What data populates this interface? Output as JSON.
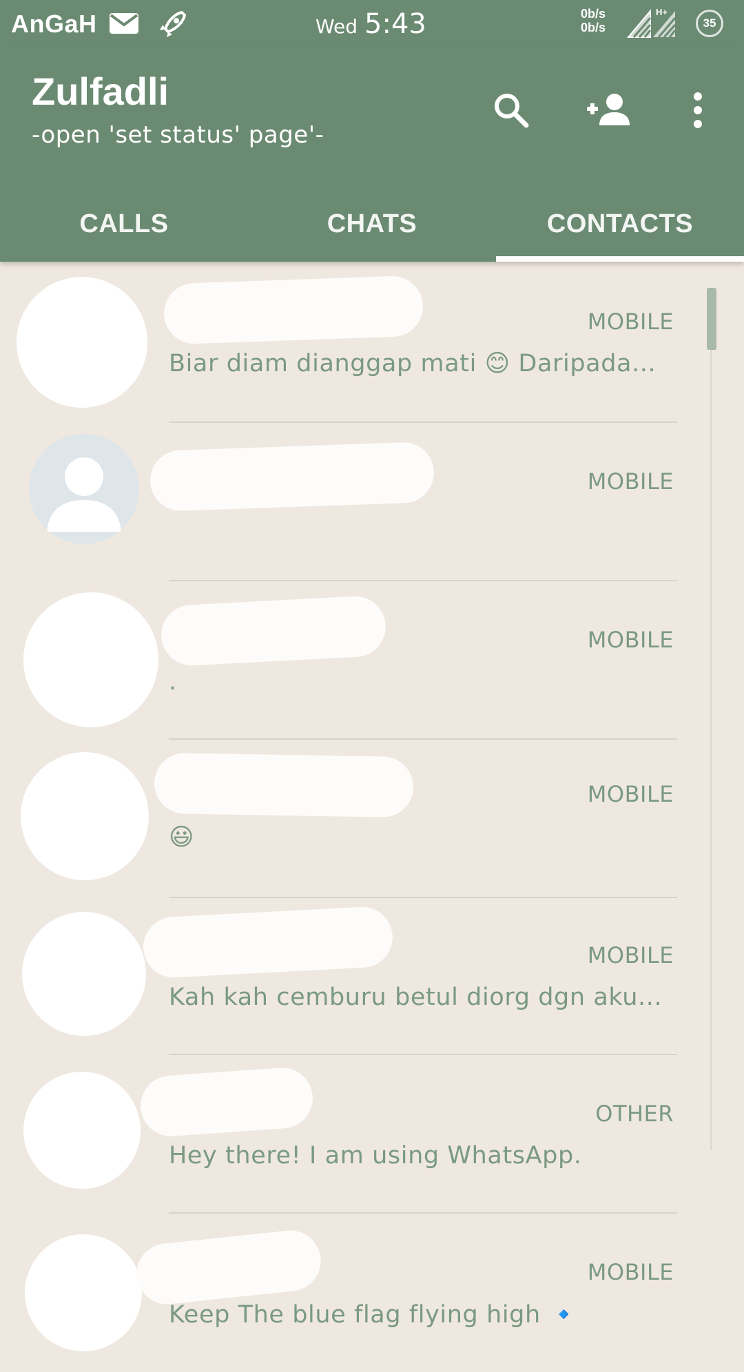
{
  "status_bar": {
    "carrier": "AnGaH",
    "day": "Wed",
    "time": "5:43",
    "net_up": "0b/s",
    "net_down": "0b/s",
    "network_type": "H+",
    "battery": "35",
    "icons": [
      "mail-icon",
      "rocket-icon",
      "signal-icon",
      "signal-hplus-icon",
      "battery-icon"
    ]
  },
  "toolbar": {
    "title": "Zulfadli",
    "subtitle": "-open 'set status' page'-",
    "icons": [
      "search-icon",
      "add-contact-icon",
      "more-options-icon"
    ]
  },
  "tabs": [
    {
      "label": "CALLS",
      "active": false
    },
    {
      "label": "CHATS",
      "active": false
    },
    {
      "label": "CONTACTS",
      "active": true
    }
  ],
  "contacts": [
    {
      "type": "MOBILE",
      "status": "Biar diam dianggap mati 😊 Daripada..."
    },
    {
      "type": "MOBILE",
      "status": ""
    },
    {
      "type": "MOBILE",
      "status": "."
    },
    {
      "type": "MOBILE",
      "status": "😃"
    },
    {
      "type": "MOBILE",
      "status": "Kah kah cemburu betul diorg dgn aku..."
    },
    {
      "type": "OTHER",
      "status": "Hey there! I am using WhatsApp."
    },
    {
      "type": "MOBILE",
      "status": "Keep The blue flag flying high 🔹"
    }
  ],
  "colors": {
    "primary": "#6b8a72",
    "background": "#efe8e0",
    "secondary_text": "#7a9a82"
  }
}
